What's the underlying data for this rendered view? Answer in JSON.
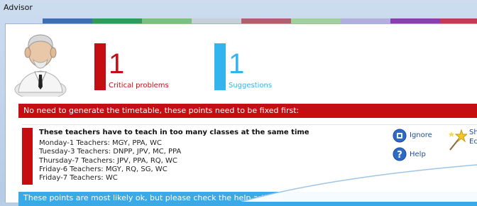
{
  "window": {
    "title": "Advisor"
  },
  "titlebar_strip": {
    "colors": [
      "#3d6fb5",
      "#2e9d57",
      "#79c27c",
      "#c7d0d9",
      "#b35d6e",
      "#9fd29b",
      "#b3aee0",
      "#8a3fb1",
      "#c23b56"
    ]
  },
  "stats": {
    "critical": {
      "count": "1",
      "label": "Critical problems",
      "color": "#c40e12"
    },
    "suggestions": {
      "count": "1",
      "label": "Suggestions",
      "color": "#34b4ef"
    }
  },
  "critical_banner": "No need to generate the timetable, these points need to be fixed first:",
  "problem": {
    "title": "These teachers have to teach in too many classes at the same time",
    "lines": [
      "Monday-1 Teachers: MGY, PPA, WC",
      "Tuesday-3 Teachers: DNPP, JPV, MC, PPA",
      "Thursday-7 Teachers: JPV, PPA, RQ, WC",
      "Friday-6 Teachers: MGY, RQ, SG, WC",
      "Friday-7 Teachers: WC"
    ]
  },
  "actions": {
    "ignore": {
      "label": "Ignore",
      "icon": "ignore-icon"
    },
    "help": {
      "label": "Help",
      "icon": "help-icon"
    },
    "wizard": {
      "label_line1": "Sh",
      "label_line2": "Ec",
      "icon": "magic-wand-icon"
    }
  },
  "suggestion_banner": "These points are most likely ok, but please check the help article t"
}
